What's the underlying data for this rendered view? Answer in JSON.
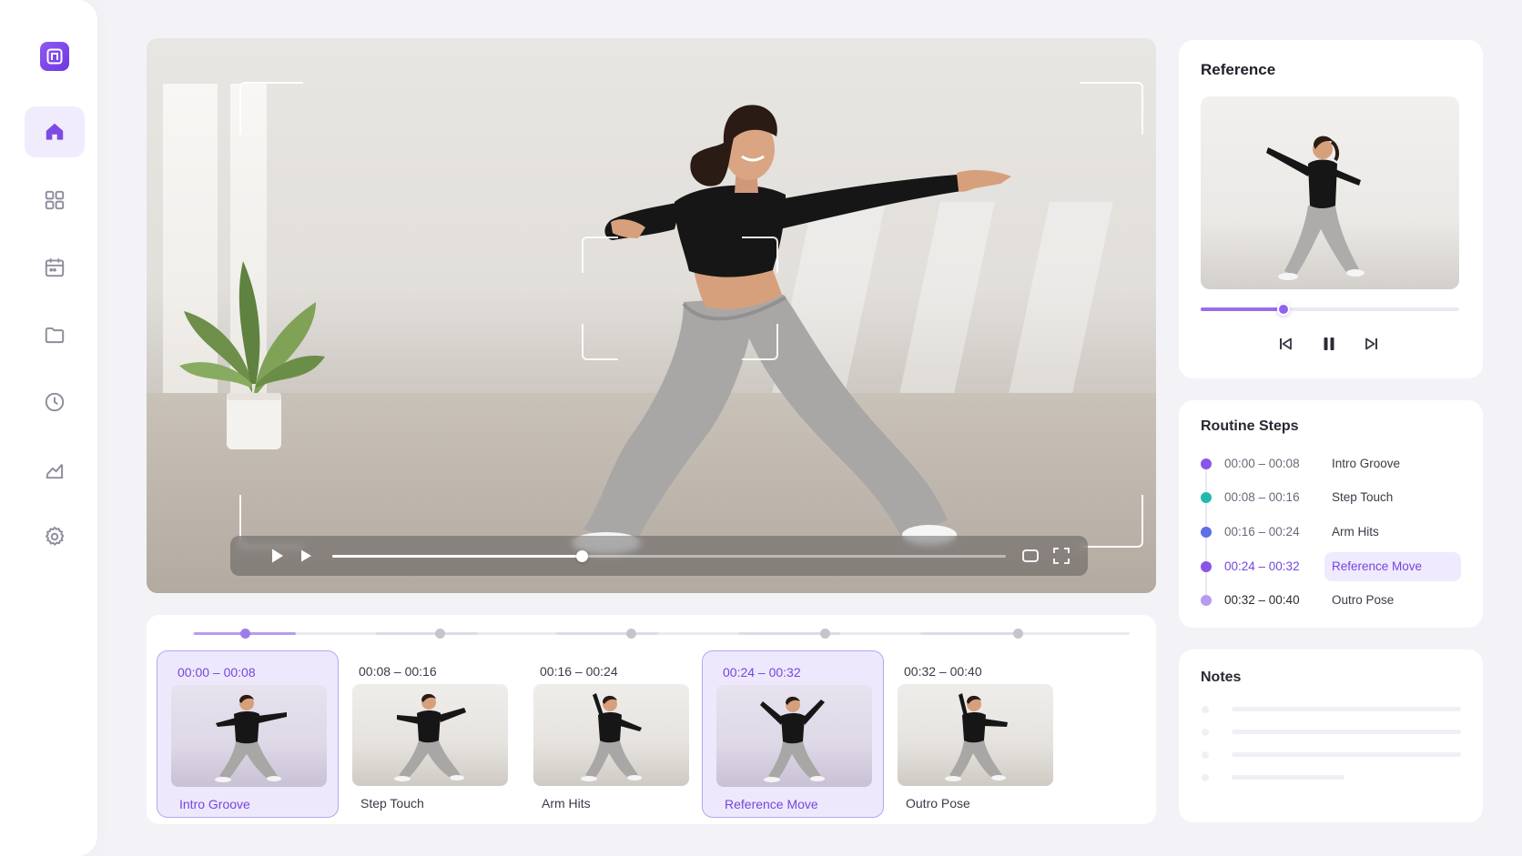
{
  "sidebar": {
    "items": [
      {
        "icon": "home-icon",
        "active": true
      },
      {
        "icon": "grid-icon",
        "active": false
      },
      {
        "icon": "calendar-icon",
        "active": false
      },
      {
        "icon": "folder-icon",
        "active": false
      },
      {
        "icon": "clock-icon",
        "active": false
      },
      {
        "icon": "chart-icon",
        "active": false
      },
      {
        "icon": "settings-icon",
        "active": false
      }
    ]
  },
  "main_video": {
    "progress": 0.37,
    "controls": [
      "play-icon",
      "play-icon",
      "pip-icon",
      "fullscreen-icon"
    ]
  },
  "timeline": {
    "steps": [
      {
        "time": "00:00 – 00:08",
        "name": "Intro Groove",
        "selected": true
      },
      {
        "time": "00:08 – 00:16",
        "name": "Step Touch",
        "selected": false
      },
      {
        "time": "00:16 – 00:24",
        "name": "Arm Hits",
        "selected": false
      },
      {
        "time": "00:24 – 00:32",
        "name": "Reference Move",
        "selected": true
      },
      {
        "time": "00:32 – 00:40",
        "name": "Outro Pose",
        "selected": false
      }
    ]
  },
  "reference": {
    "title": "Reference",
    "progress": 0.32,
    "controls": [
      "skip-back-icon",
      "pause-icon",
      "skip-forward-icon"
    ]
  },
  "routine_steps": {
    "title": "Routine Steps",
    "items": [
      {
        "time": "00:00 – 00:08",
        "name": "Intro Groove",
        "color": "#8a55e6",
        "state": "done"
      },
      {
        "time": "00:08 – 00:16",
        "name": "Step Touch",
        "color": "#22b8b0",
        "state": "done"
      },
      {
        "time": "00:16 – 00:24",
        "name": "Arm Hits",
        "color": "#5b6fe6",
        "state": "done"
      },
      {
        "time": "00:24 – 00:32",
        "name": "Reference Move",
        "color": "#8a55e6",
        "state": "current"
      },
      {
        "time": "00:32 – 00:40",
        "name": "Outro Pose",
        "color": "#b79bef",
        "state": "upcoming"
      }
    ]
  },
  "notes": {
    "title": "Notes"
  },
  "colors": {
    "accent": "#7446dd",
    "accent_soft": "#eee8fd",
    "background": "#f3f3f7"
  }
}
